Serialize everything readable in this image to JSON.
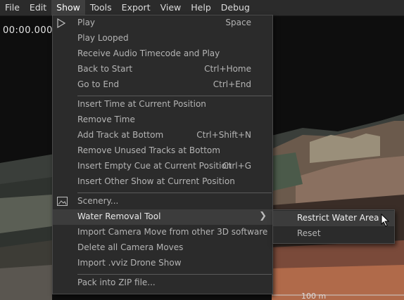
{
  "menubar": {
    "items": [
      {
        "label": "File"
      },
      {
        "label": "Edit"
      },
      {
        "label": "Show"
      },
      {
        "label": "Tools"
      },
      {
        "label": "Export"
      },
      {
        "label": "View"
      },
      {
        "label": "Help"
      },
      {
        "label": "Debug"
      }
    ],
    "active": "Show"
  },
  "viewport": {
    "timecode": "00:00.000",
    "scale_label": "100 m"
  },
  "show_menu": {
    "items": [
      {
        "label": "Play",
        "shortcut": "Space",
        "icon": "play-icon"
      },
      {
        "label": "Play Looped",
        "shortcut": ""
      },
      {
        "label": "Receive Audio Timecode and Play",
        "shortcut": ""
      },
      {
        "label": "Back to Start",
        "shortcut": "Ctrl+Home"
      },
      {
        "label": "Go to End",
        "shortcut": "Ctrl+End"
      },
      {
        "label": "Insert Time at Current Position",
        "shortcut": ""
      },
      {
        "label": "Remove Time",
        "shortcut": ""
      },
      {
        "label": "Add Track at Bottom",
        "shortcut": "Ctrl+Shift+N"
      },
      {
        "label": "Remove Unused Tracks at Bottom",
        "shortcut": ""
      },
      {
        "label": "Insert Empty Cue at Current Position",
        "shortcut": "Ctrl+G"
      },
      {
        "label": "Insert Other Show at Current Position",
        "shortcut": ""
      },
      {
        "label": "Scenery...",
        "shortcut": "",
        "icon": "image-icon"
      },
      {
        "label": "Water Removal Tool",
        "shortcut": "",
        "submenu": true
      },
      {
        "label": "Import Camera Move from other 3D software",
        "shortcut": ""
      },
      {
        "label": "Delete all Camera Moves",
        "shortcut": ""
      },
      {
        "label": "Import .vviz Drone Show",
        "shortcut": ""
      },
      {
        "label": "Pack into ZIP file...",
        "shortcut": ""
      }
    ],
    "highlighted": "Water Removal Tool"
  },
  "water_submenu": {
    "items": [
      {
        "label": "Restrict Water Area"
      },
      {
        "label": "Reset"
      }
    ],
    "highlighted": "Restrict Water Area"
  },
  "colors": {
    "menu_bg": "#2b2b2b",
    "highlight_bg": "#3c3c3c",
    "text": "#b4b4b4"
  }
}
